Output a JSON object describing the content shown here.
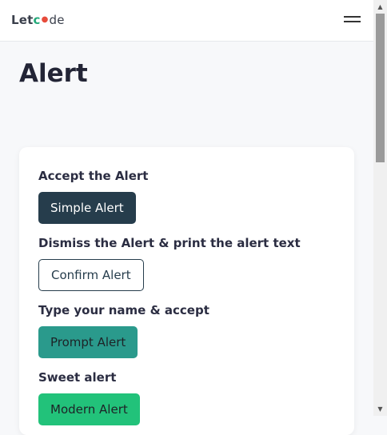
{
  "header": {
    "logo_let": "Let",
    "logo_c": "c",
    "logo_dot": "●",
    "logo_de": "de"
  },
  "page": {
    "title": "Alert"
  },
  "alerts": {
    "accept_label": "Accept the Alert",
    "simple_button": "Simple Alert",
    "dismiss_label": "Dismiss the Alert & print the alert text",
    "confirm_button": "Confirm Alert",
    "prompt_label": "Type your name & accept",
    "prompt_button": "Prompt Alert",
    "sweet_label": "Sweet alert",
    "modern_button": "Modern Alert"
  },
  "scrollbar": {
    "up_icon": "▲",
    "down_icon": "▼"
  },
  "colors": {
    "dark_button": "#263d4c",
    "teal_button": "#2a9a8c",
    "green_button": "#22c27a"
  }
}
